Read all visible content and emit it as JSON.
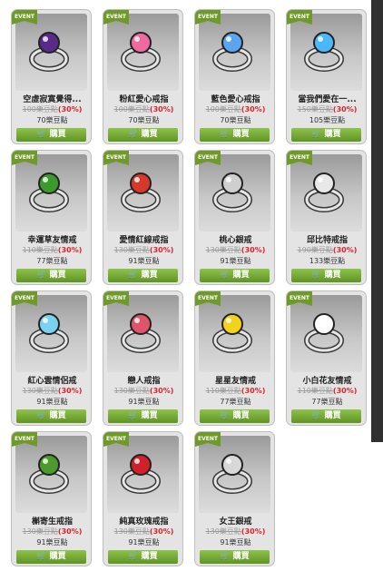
{
  "tag": "EVENT",
  "buy": "購買",
  "cart": "cart-icon",
  "items": [
    {
      "name": "空虛寂寞覺得...",
      "old": "100樂豆點",
      "pct": "(30%)",
      "now": "70樂豆點",
      "icon": "purple-gem-ring-icon",
      "c": "#5a2a8a"
    },
    {
      "name": "粉紅愛心戒指",
      "old": "100樂豆點",
      "pct": "(30%)",
      "now": "70樂豆點",
      "icon": "pink-heart-ring-icon",
      "c": "#f06aa0"
    },
    {
      "name": "藍色愛心戒指",
      "old": "100樂豆點",
      "pct": "(30%)",
      "now": "70樂豆點",
      "icon": "blue-heart-ring-icon",
      "c": "#5aa4f0"
    },
    {
      "name": "當我們愛在一...",
      "old": "150樂豆點",
      "pct": "(30%)",
      "now": "105樂豆點",
      "icon": "snowflake-ring-icon",
      "c": "#4ab8ff"
    },
    {
      "name": "幸運草友情戒",
      "old": "110樂豆點",
      "pct": "(30%)",
      "now": "77樂豆點",
      "icon": "clover-ring-icon",
      "c": "#3c9a2c"
    },
    {
      "name": "愛情紅線戒指",
      "old": "130樂豆點",
      "pct": "(30%)",
      "now": "91樂豆點",
      "icon": "red-thread-ring-icon",
      "c": "#d8382a"
    },
    {
      "name": "桃心銀戒",
      "old": "130樂豆點",
      "pct": "(30%)",
      "now": "91樂豆點",
      "icon": "silver-heart-ring-icon",
      "c": "#cfcfcf"
    },
    {
      "name": "邱比特戒指",
      "old": "190樂豆點",
      "pct": "(30%)",
      "now": "133樂豆點",
      "icon": "cupid-ring-icon",
      "c": "#e8e8e8"
    },
    {
      "name": "紅心雲情侶戒",
      "old": "130樂豆點",
      "pct": "(30%)",
      "now": "91樂豆點",
      "icon": "heart-cloud-ring-icon",
      "c": "#7ad2f0"
    },
    {
      "name": "戀人戒指",
      "old": "130樂豆點",
      "pct": "(30%)",
      "now": "91樂豆點",
      "icon": "lovers-ring-icon",
      "c": "#e0546a"
    },
    {
      "name": "星星友情戒",
      "old": "110樂豆點",
      "pct": "(30%)",
      "now": "77樂豆點",
      "icon": "star-ring-icon",
      "c": "#f2d21a"
    },
    {
      "name": "小白花友情戒",
      "old": "110樂豆點",
      "pct": "(30%)",
      "now": "77樂豆點",
      "icon": "white-flower-ring-icon",
      "c": "#ffffff"
    },
    {
      "name": "槲寄生戒指",
      "old": "130樂豆點",
      "pct": "(30%)",
      "now": "91樂豆點",
      "icon": "mistletoe-ring-icon",
      "c": "#4a9a2c"
    },
    {
      "name": "純真玫瑰戒指",
      "old": "130樂豆點",
      "pct": "(30%)",
      "now": "91樂豆點",
      "icon": "rose-ring-icon",
      "c": "#d0202a"
    },
    {
      "name": "女王銀戒",
      "old": "130樂豆點",
      "pct": "(30%)",
      "now": "91樂豆點",
      "icon": "queen-silver-ring-icon",
      "c": "#d8d8d8"
    }
  ]
}
